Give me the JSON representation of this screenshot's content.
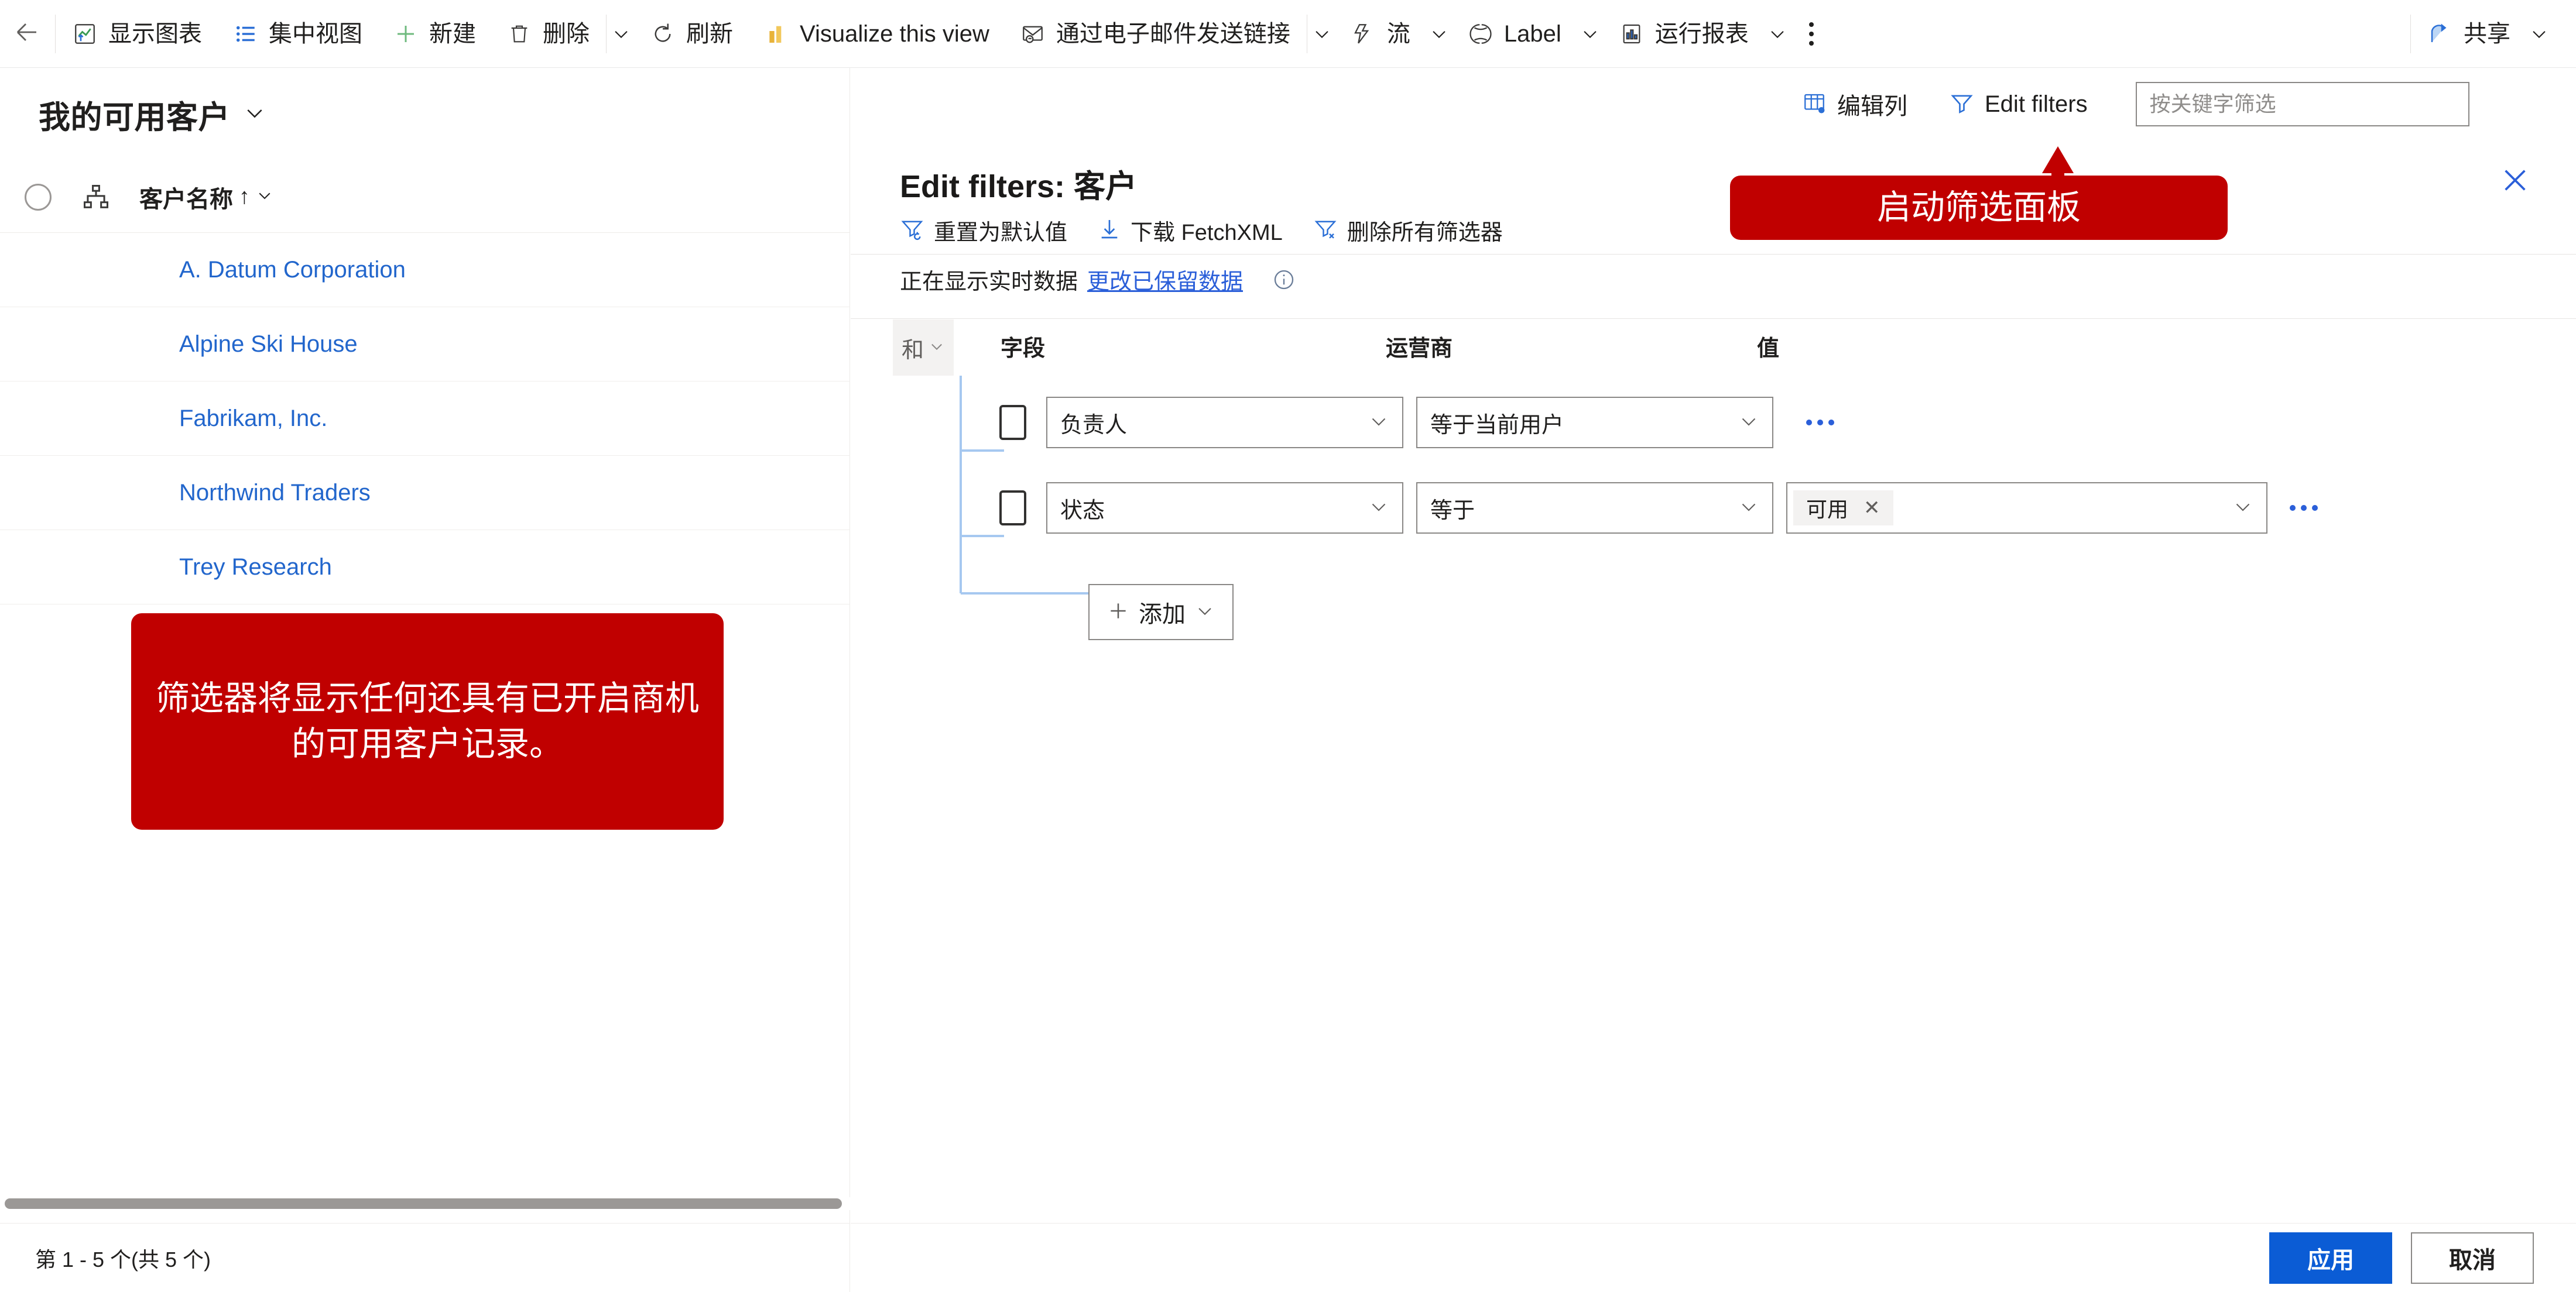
{
  "commandbar": {
    "back_icon": "back-arrow-icon",
    "items": [
      {
        "id": "show-chart",
        "icon": "chart-icon",
        "label": "显示图表"
      },
      {
        "id": "focused-view",
        "icon": "list-icon",
        "label": "集中视图"
      },
      {
        "id": "new",
        "icon": "plus-icon",
        "label": "新建"
      },
      {
        "id": "delete",
        "icon": "trash-icon",
        "label": "删除"
      },
      {
        "id": "refresh",
        "icon": "refresh-icon",
        "label": "刷新"
      },
      {
        "id": "visualize",
        "icon": "powerbi-icon",
        "label": "Visualize this view"
      },
      {
        "id": "email-link",
        "icon": "email-link-icon",
        "label": "通过电子邮件发送链接"
      },
      {
        "id": "flow",
        "icon": "flow-icon",
        "label": "流"
      },
      {
        "id": "label",
        "icon": "label-icon",
        "label": "Label"
      },
      {
        "id": "run-report",
        "icon": "report-icon",
        "label": "运行报表"
      }
    ],
    "share": {
      "icon": "share-icon",
      "label": "共享"
    },
    "overflow_icon": "more-vertical-icon"
  },
  "listpane": {
    "view_title": "我的可用客户",
    "view_title_chevron": "chevron-down-icon",
    "header": {
      "select_all_icon": "radio-circle-icon",
      "hierarchy_icon": "hierarchy-icon",
      "column_label": "客户名称",
      "sort_indicator": "↑"
    },
    "rows": [
      {
        "name": "A. Datum Corporation"
      },
      {
        "name": "Alpine Ski House"
      },
      {
        "name": "Fabrikam, Inc."
      },
      {
        "name": "Northwind Traders"
      },
      {
        "name": "Trey Research"
      }
    ],
    "footer_text": "第 1 - 5 个(共 5 个)"
  },
  "filterpanel": {
    "toprow": {
      "edit_columns": {
        "icon": "edit-columns-icon",
        "label": "编辑列"
      },
      "edit_filters": {
        "icon": "funnel-icon",
        "label": "Edit filters"
      }
    },
    "search": {
      "placeholder": "按关键字筛选",
      "value": ""
    },
    "title": "Edit filters: 客户",
    "close_icon": "close-icon",
    "actions": [
      {
        "id": "reset-default",
        "icon": "funnel-reset-icon",
        "label": "重置为默认值"
      },
      {
        "id": "download-fetchxml",
        "icon": "download-icon",
        "label": "下载 FetchXML"
      },
      {
        "id": "remove-all-filters",
        "icon": "funnel-clear-icon",
        "label": "删除所有筛选器"
      }
    ],
    "live_data": {
      "text": "正在显示实时数据",
      "link": "更改已保留数据",
      "info_icon": "info-icon"
    },
    "grouping": {
      "operator": "和",
      "chevron": "chevron-down-icon"
    },
    "columns": {
      "field": "字段",
      "operator": "运营商",
      "value": "值"
    },
    "rows": [
      {
        "checked": false,
        "field": "负责人",
        "operator": "等于当前用户",
        "value_tags": [],
        "has_value_box": false,
        "more_icon": "more-horizontal-icon"
      },
      {
        "checked": false,
        "field": "状态",
        "operator": "等于",
        "value_tags": [
          {
            "label": "可用",
            "remove_icon": "close-small-icon"
          }
        ],
        "has_value_box": true,
        "more_icon": "more-horizontal-icon"
      }
    ],
    "add_button": {
      "icon": "plus-icon",
      "label": "添加",
      "chevron": "chevron-down-icon"
    },
    "footer": {
      "apply": "应用",
      "cancel": "取消"
    }
  },
  "callouts": [
    {
      "id": "filter-pane-callout",
      "text": "启动筛选面板"
    },
    {
      "id": "filter-explain-callout",
      "text": "筛选器将显示任何还具有已开启商机的可用客户记录。"
    }
  ],
  "colors": {
    "callout_red": "#c00000",
    "link_blue": "#2266cc",
    "primary_blue": "#0b5cd5",
    "accent_blue": "#2b5fd9"
  }
}
